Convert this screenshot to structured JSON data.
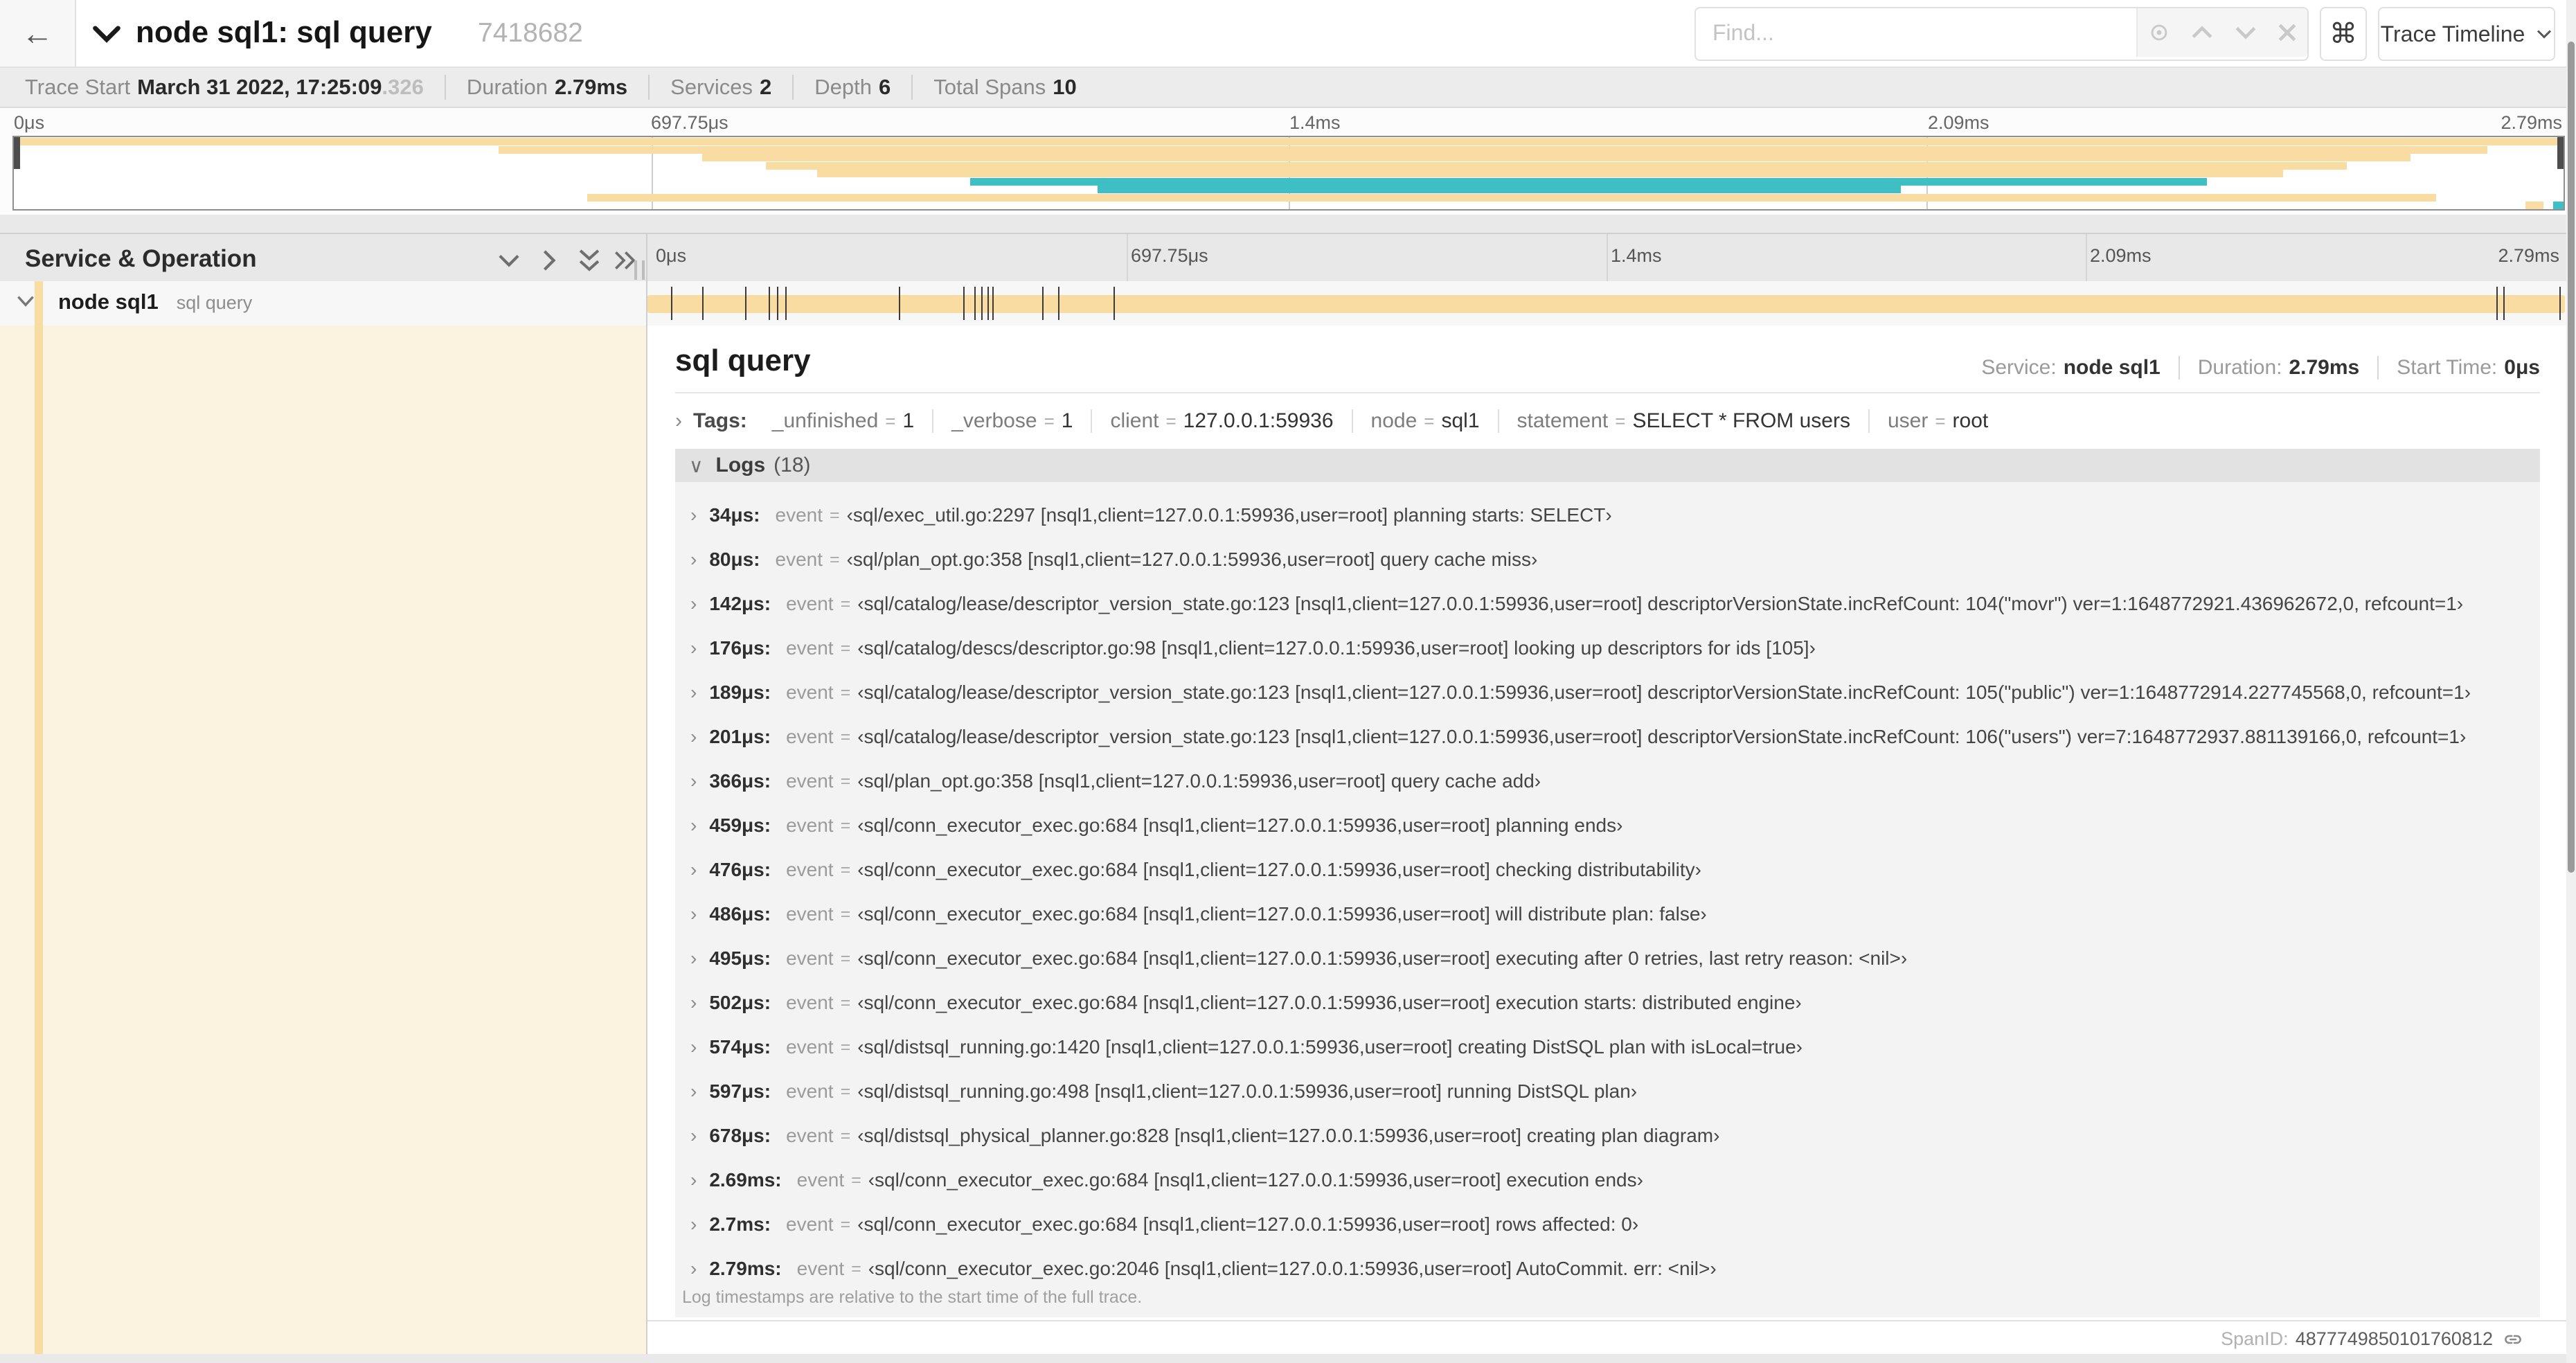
{
  "header": {
    "back_icon": "←",
    "title": "node sql1: sql query",
    "trace_id": "7418682",
    "find_placeholder": "Find...",
    "shortcut_icon": "⌘",
    "view_select_label": "Trace Timeline"
  },
  "summary": {
    "trace_start": {
      "label": "Trace Start",
      "value": "March 31 2022, 17:25:09",
      "fraction": ".326"
    },
    "duration": {
      "label": "Duration",
      "value": "2.79ms"
    },
    "services": {
      "label": "Services",
      "value": "2"
    },
    "depth": {
      "label": "Depth",
      "value": "6"
    },
    "total_spans": {
      "label": "Total Spans",
      "value": "10"
    }
  },
  "timeline": {
    "span_table_header": "Service & Operation",
    "ticks": [
      "0μs",
      "697.75μs",
      "1.4ms",
      "2.09ms",
      "2.79ms"
    ],
    "log_marker_fractions": [
      0.0122,
      0.0287,
      0.0509,
      0.0631,
      0.0677,
      0.072,
      0.1312,
      0.1645,
      0.1706,
      0.1742,
      0.1774,
      0.1799,
      0.2057,
      0.214,
      0.243,
      0.9642,
      0.9677,
      0.997
    ]
  },
  "minimap_rows": [
    [
      {
        "start": 0,
        "end": 1,
        "color": "tan"
      }
    ],
    [
      {
        "start": 0.19,
        "end": 0.97,
        "color": "tan"
      }
    ],
    [
      {
        "start": 0.27,
        "end": 0.94,
        "color": "tan"
      }
    ],
    [
      {
        "start": 0.295,
        "end": 0.915,
        "color": "tan"
      }
    ],
    [
      {
        "start": 0.315,
        "end": 0.89,
        "color": "tan"
      }
    ],
    [
      {
        "start": 0.375,
        "end": 0.86,
        "color": "teal"
      }
    ],
    [
      {
        "start": 0.425,
        "end": 0.74,
        "color": "teal"
      }
    ],
    [
      {
        "start": 0.225,
        "end": 0.95,
        "color": "tan"
      }
    ],
    [
      {
        "start": 0.985,
        "end": 0.992,
        "color": "tan"
      },
      {
        "start": 0.996,
        "end": 1,
        "color": "teal"
      }
    ]
  ],
  "span": {
    "service": "node sql1",
    "operation": "sql query"
  },
  "detail": {
    "title": "sql query",
    "service_label": "Service:",
    "service": "node sql1",
    "duration_label": "Duration:",
    "duration": "2.79ms",
    "start_label": "Start Time:",
    "start": "0μs",
    "tags_label": "Tags:",
    "tags": [
      {
        "key": "_unfinished",
        "value": "1"
      },
      {
        "key": "_verbose",
        "value": "1"
      },
      {
        "key": "client",
        "value": "127.0.0.1:59936"
      },
      {
        "key": "node",
        "value": "sql1"
      },
      {
        "key": "statement",
        "value": "SELECT * FROM users"
      },
      {
        "key": "user",
        "value": "root"
      }
    ],
    "logs_label": "Logs",
    "logs_count": "(18)",
    "logs": [
      {
        "time": "34μs:",
        "field": "event",
        "value": "‹sql/exec_util.go:2297 [nsql1,client=127.0.0.1:59936,user=root] planning starts: SELECT›"
      },
      {
        "time": "80μs:",
        "field": "event",
        "value": "‹sql/plan_opt.go:358 [nsql1,client=127.0.0.1:59936,user=root] query cache miss›"
      },
      {
        "time": "142μs:",
        "field": "event",
        "value": "‹sql/catalog/lease/descriptor_version_state.go:123 [nsql1,client=127.0.0.1:59936,user=root] descriptorVersionState.incRefCount: 104(\"movr\") ver=1:1648772921.436962672,0, refcount=1›"
      },
      {
        "time": "176μs:",
        "field": "event",
        "value": "‹sql/catalog/descs/descriptor.go:98 [nsql1,client=127.0.0.1:59936,user=root] looking up descriptors for ids [105]›"
      },
      {
        "time": "189μs:",
        "field": "event",
        "value": "‹sql/catalog/lease/descriptor_version_state.go:123 [nsql1,client=127.0.0.1:59936,user=root] descriptorVersionState.incRefCount: 105(\"public\") ver=1:1648772914.227745568,0, refcount=1›"
      },
      {
        "time": "201μs:",
        "field": "event",
        "value": "‹sql/catalog/lease/descriptor_version_state.go:123 [nsql1,client=127.0.0.1:59936,user=root] descriptorVersionState.incRefCount: 106(\"users\") ver=7:1648772937.881139166,0, refcount=1›"
      },
      {
        "time": "366μs:",
        "field": "event",
        "value": "‹sql/plan_opt.go:358 [nsql1,client=127.0.0.1:59936,user=root] query cache add›"
      },
      {
        "time": "459μs:",
        "field": "event",
        "value": "‹sql/conn_executor_exec.go:684 [nsql1,client=127.0.0.1:59936,user=root] planning ends›"
      },
      {
        "time": "476μs:",
        "field": "event",
        "value": "‹sql/conn_executor_exec.go:684 [nsql1,client=127.0.0.1:59936,user=root] checking distributability›"
      },
      {
        "time": "486μs:",
        "field": "event",
        "value": "‹sql/conn_executor_exec.go:684 [nsql1,client=127.0.0.1:59936,user=root] will distribute plan: false›"
      },
      {
        "time": "495μs:",
        "field": "event",
        "value": "‹sql/conn_executor_exec.go:684 [nsql1,client=127.0.0.1:59936,user=root] executing after 0 retries, last retry reason: <nil>›"
      },
      {
        "time": "502μs:",
        "field": "event",
        "value": "‹sql/conn_executor_exec.go:684 [nsql1,client=127.0.0.1:59936,user=root] execution starts: distributed engine›"
      },
      {
        "time": "574μs:",
        "field": "event",
        "value": "‹sql/distsql_running.go:1420 [nsql1,client=127.0.0.1:59936,user=root] creating DistSQL plan with isLocal=true›"
      },
      {
        "time": "597μs:",
        "field": "event",
        "value": "‹sql/distsql_running.go:498 [nsql1,client=127.0.0.1:59936,user=root] running DistSQL plan›"
      },
      {
        "time": "678μs:",
        "field": "event",
        "value": "‹sql/distsql_physical_planner.go:828 [nsql1,client=127.0.0.1:59936,user=root] creating plan diagram›"
      },
      {
        "time": "2.69ms:",
        "field": "event",
        "value": "‹sql/conn_executor_exec.go:684 [nsql1,client=127.0.0.1:59936,user=root] execution ends›"
      },
      {
        "time": "2.7ms:",
        "field": "event",
        "value": "‹sql/conn_executor_exec.go:684 [nsql1,client=127.0.0.1:59936,user=root] rows affected: 0›"
      },
      {
        "time": "2.79ms:",
        "field": "event",
        "value": "‹sql/conn_executor_exec.go:2046 [nsql1,client=127.0.0.1:59936,user=root] AutoCommit. err: <nil>›"
      }
    ],
    "footnote": "Log timestamps are relative to the start time of the full trace.",
    "spanid_label": "SpanID:",
    "spanid": "4877749850101760812"
  },
  "colors": {
    "tan": "#F8DCA1",
    "teal": "#3DBFC4",
    "cream": "#FBF2E0",
    "marker": "#3b3b3b"
  }
}
